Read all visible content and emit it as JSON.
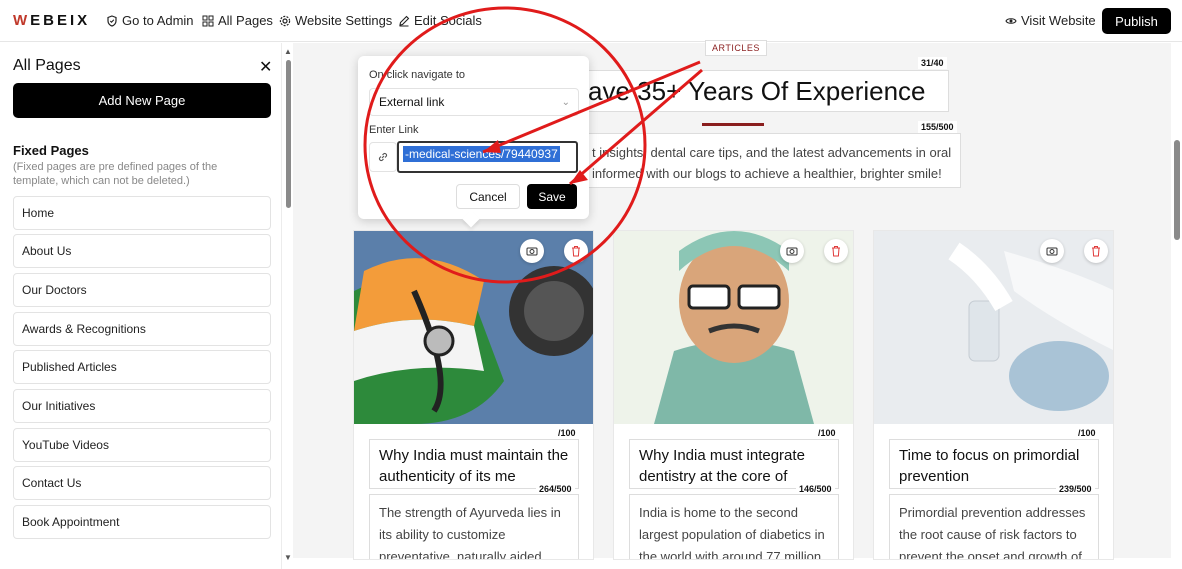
{
  "topbar": {
    "logo": "WEBEIX",
    "logo_first": "W",
    "logo_rest": "EBEIX",
    "nav": [
      "Go to Admin",
      "All Pages",
      "Website Settings",
      "Edit Socials"
    ],
    "visit": "Visit Website",
    "publish": "Publish"
  },
  "sidebar": {
    "title": "All Pages",
    "add_button": "Add New Page",
    "fixed_heading": "Fixed Pages",
    "fixed_sub": "(Fixed pages are pre defined pages of the template, which can not be deleted.)",
    "pages": [
      "Home",
      "About Us",
      "Our Doctors",
      "Awards & Recognitions",
      "Published Articles",
      "Our Initiatives",
      "YouTube Videos",
      "Contact Us",
      "Book Appointment"
    ]
  },
  "main": {
    "tag": "ARTICLES",
    "heading": "ave 35+ Years Of Experience",
    "heading_counter": "31/40",
    "desc_counter": "155/500",
    "desc_line1": "t insights, dental care tips, and the latest advancements in oral",
    "desc_line2": "informed with our blogs to achieve a healthier, brighter smile!",
    "cards": [
      {
        "title_counter": "/100",
        "title": "Why India must maintain the authenticity of its me",
        "text_counter": "264/500",
        "text": "The strength of Ayurveda lies in its ability to customize preventative, naturally aided,"
      },
      {
        "title_counter": "/100",
        "title": "Why India must integrate dentistry at the core of",
        "text_counter": "146/500",
        "text": "India is home to the second largest population of diabetics in the world with around 77 million"
      },
      {
        "title_counter": "/100",
        "title": "Time to focus on primordial prevention",
        "text_counter": "239/500",
        "text": "Primordial prevention addresses the root cause of risk factors to prevent the onset and growth of"
      }
    ]
  },
  "popup": {
    "nav_label": "On click navigate to",
    "select_value": "External link",
    "link_label": "Enter Link",
    "link_value": "-medical-sciences/79440937",
    "cancel": "Cancel",
    "save": "Save"
  },
  "annotation_color": "#e01b1b"
}
